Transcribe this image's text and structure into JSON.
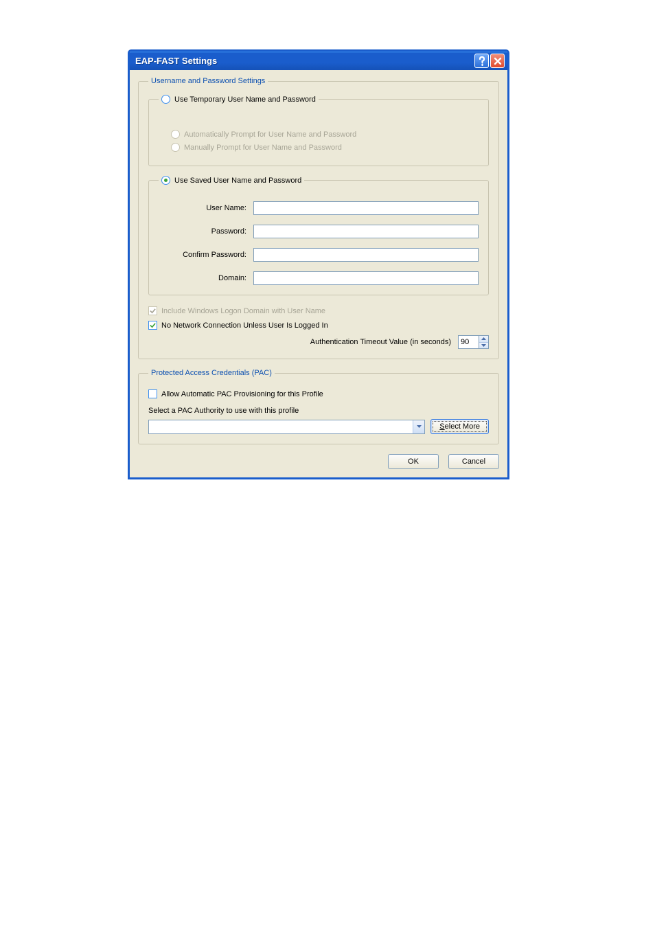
{
  "window": {
    "title": "EAP-FAST Settings"
  },
  "group1": {
    "legend": "Username and Password Settings",
    "temp": {
      "label": "Use Temporary User Name and Password",
      "autoPrompt": "Automatically Prompt for User Name and Password",
      "manualPrompt": "Manually Prompt for User Name and Password"
    },
    "saved": {
      "label": "Use Saved User Name and Password",
      "userNameLabel": "User Name:",
      "userNameValue": "",
      "passwordLabel": "Password:",
      "passwordValue": "",
      "confirmLabel": "Confirm Password:",
      "confirmValue": "",
      "domainLabel": "Domain:",
      "domainValue": ""
    },
    "checks": {
      "includeDomain": "Include Windows Logon Domain with User Name",
      "noNetwork": "No Network Connection Unless User Is Logged In",
      "timeoutLabel": "Authentication Timeout Value (in seconds)",
      "timeoutValue": "90"
    }
  },
  "group2": {
    "legend": "Protected Access Credentials (PAC)",
    "allowPac": "Allow Automatic PAC Provisioning for this Profile",
    "selectLabel": "Select a PAC Authority to use with this profile",
    "comboValue": "",
    "selectMore": "Select More"
  },
  "buttons": {
    "ok": "OK",
    "cancel": "Cancel"
  }
}
